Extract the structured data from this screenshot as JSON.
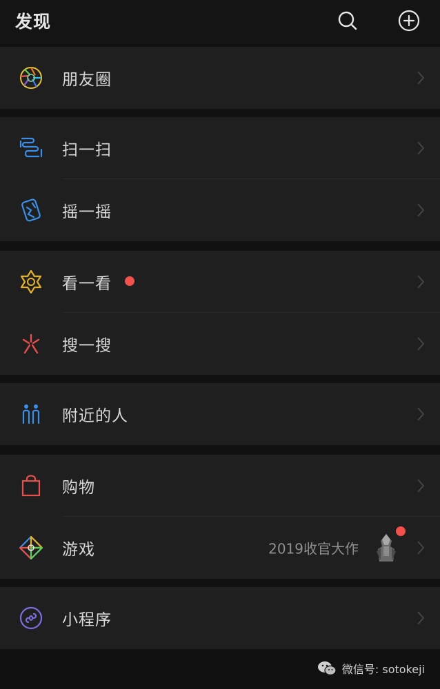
{
  "header": {
    "title": "发现",
    "search_icon": "search-icon",
    "add_icon": "plus-circle-icon"
  },
  "items": [
    {
      "label": "朋友圈",
      "icon": "moments-aperture-icon"
    },
    {
      "label": "扫一扫",
      "icon": "scan-icon"
    },
    {
      "label": "摇一摇",
      "icon": "shake-icon"
    },
    {
      "label": "看一看",
      "icon": "top-stories-icon"
    },
    {
      "label": "搜一搜",
      "icon": "search-star-icon"
    },
    {
      "label": "附近的人",
      "icon": "people-nearby-icon"
    },
    {
      "label": "购物",
      "icon": "shopping-bag-icon"
    },
    {
      "label": "游戏",
      "icon": "games-icon",
      "extra_text": "2019收官大作"
    },
    {
      "label": "小程序",
      "icon": "mini-programs-icon"
    }
  ],
  "watermark": {
    "text": "微信号: sotokeji"
  },
  "colors": {
    "background": "#111111",
    "row": "#1f1f1f",
    "badge": "#f2504b",
    "label": "#d8d8d8"
  }
}
